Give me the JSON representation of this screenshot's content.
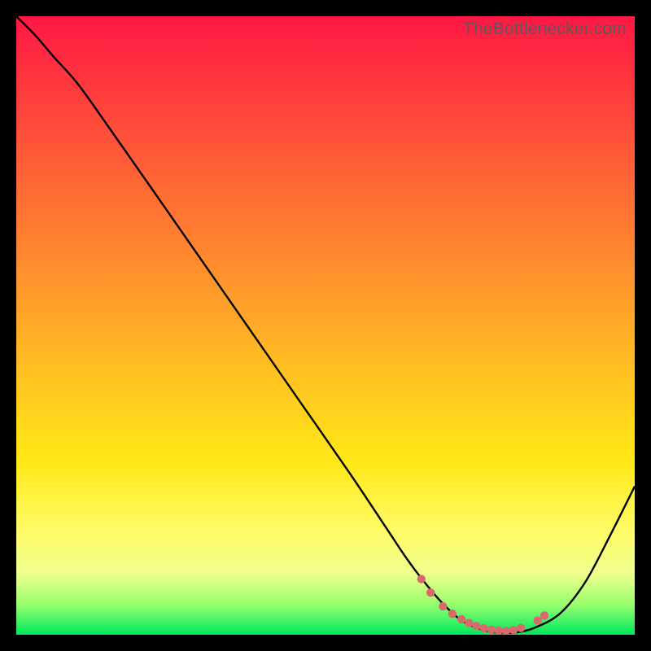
{
  "watermark": "TheBottlenecker.com",
  "chart_data": {
    "type": "line",
    "title": "",
    "xlabel": "",
    "ylabel": "",
    "xlim": [
      0,
      100
    ],
    "ylim": [
      0,
      100
    ],
    "grid": false,
    "legend": false,
    "gradient_stops": [
      {
        "offset": 0,
        "color": "#ff1744"
      },
      {
        "offset": 18,
        "color": "#ff4d3a"
      },
      {
        "offset": 40,
        "color": "#ff8c2e"
      },
      {
        "offset": 58,
        "color": "#ffc221"
      },
      {
        "offset": 72,
        "color": "#ffe817"
      },
      {
        "offset": 83,
        "color": "#fffb66"
      },
      {
        "offset": 90,
        "color": "#f0ff8c"
      },
      {
        "offset": 95,
        "color": "#9aff6e"
      },
      {
        "offset": 100,
        "color": "#00e85e"
      }
    ],
    "series": [
      {
        "name": "bottleneck-curve",
        "color": "#000000",
        "x": [
          0,
          3,
          6,
          10,
          15,
          22,
          30,
          38,
          46,
          54,
          60,
          63,
          66,
          69,
          72,
          75,
          78,
          81,
          84,
          88,
          92,
          96,
          100
        ],
        "y": [
          100,
          97,
          93.5,
          89,
          82,
          72,
          60.5,
          49,
          37.5,
          26,
          17,
          12.5,
          8.5,
          5,
          2.3,
          0.9,
          0.3,
          0.4,
          1.2,
          3.5,
          8.5,
          16,
          24
        ]
      }
    ],
    "markers": {
      "name": "optimal-range-dots",
      "color": "#d66b6b",
      "points": [
        {
          "x": 65.5,
          "y": 9.0
        },
        {
          "x": 67.0,
          "y": 6.8
        },
        {
          "x": 69.0,
          "y": 4.6
        },
        {
          "x": 70.5,
          "y": 3.4
        },
        {
          "x": 72.0,
          "y": 2.5
        },
        {
          "x": 73.2,
          "y": 1.9
        },
        {
          "x": 74.4,
          "y": 1.4
        },
        {
          "x": 75.6,
          "y": 1.05
        },
        {
          "x": 76.8,
          "y": 0.8
        },
        {
          "x": 78.0,
          "y": 0.65
        },
        {
          "x": 79.2,
          "y": 0.6
        },
        {
          "x": 80.4,
          "y": 0.75
        },
        {
          "x": 81.6,
          "y": 1.1
        },
        {
          "x": 84.3,
          "y": 2.3
        },
        {
          "x": 85.4,
          "y": 3.1
        }
      ]
    }
  }
}
